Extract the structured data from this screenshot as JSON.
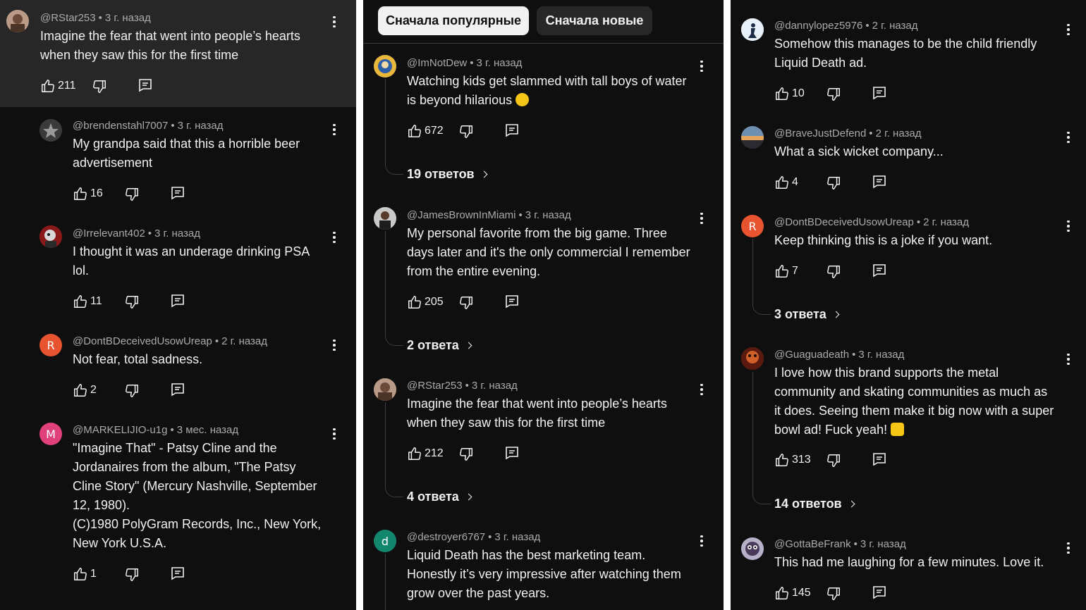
{
  "sort_chips": {
    "popular": "Сначала популярные",
    "new": "Сначала новые"
  },
  "col1": [
    {
      "author": "@RStar253",
      "time": "3 г. назад",
      "text": "Imagine the fear that went into people’s hearts\nwhen they saw this for the first time",
      "likes": "211"
    },
    {
      "author": "@brendenstahl7007",
      "time": "3 г. назад",
      "text": "My grandpa said that this a horrible beer\nadvertisement",
      "likes": "16"
    },
    {
      "author": "@Irrelevant402",
      "time": "3 г. назад",
      "text": "I thought it was an underage drinking PSA\nlol.",
      "likes": "11"
    },
    {
      "author": "@DontBDeceivedUsowUreap",
      "time": "2 г. назад",
      "text": "Not fear, total sadness.",
      "likes": "2",
      "initial": "R"
    },
    {
      "author": "@MARKELIJIO-u1g",
      "time": "3 мес. назад",
      "text": "\"Imagine That\" - Patsy Cline and the\nJordanaires from the album, \"The Patsy\nCline Story\" (Mercury Nashville, September\n12, 1980).\n(C)1980 PolyGram Records, Inc., New York,\nNew York U.S.A.",
      "likes": "1",
      "initial": "M"
    }
  ],
  "col2": [
    {
      "author": "@ImNotDew",
      "time": "3 г. назад",
      "text": "Watching kids get slammed with tall boys of water\nis beyond hilarious",
      "likes": "672",
      "replies": "19 ответов"
    },
    {
      "author": "@JamesBrownInMiami",
      "time": "3 г. назад",
      "text": "My personal favorite from the big game. Three\ndays later and it's the only commercial I remember\nfrom the entire evening.",
      "likes": "205",
      "replies": "2 ответа"
    },
    {
      "author": "@RStar253",
      "time": "3 г. назад",
      "text": "Imagine the fear that went into people’s hearts\nwhen they saw this for the first time",
      "likes": "212",
      "replies": "4 ответа"
    },
    {
      "author": "@destroyer6767",
      "time": "3 г. назад",
      "text": "Liquid Death has the best marketing team.\nHonestly it’s very impressive after watching them\ngrow over the past years.",
      "initial": "d"
    }
  ],
  "col3": [
    {
      "author": "@dannylopez5976",
      "time": "2 г. назад",
      "text": "Somehow this manages to be the child friendly\nLiquid Death ad.",
      "likes": "10"
    },
    {
      "author": "@BraveJustDefend",
      "time": "2 г. назад",
      "text": "What a sick wicket company...",
      "likes": "4"
    },
    {
      "author": "@DontBDeceivedUsowUreap",
      "time": "2 г. назад",
      "text": "Keep thinking this is a joke if you want.",
      "likes": "7",
      "initial": "R",
      "replies": "3 ответа"
    },
    {
      "author": "@Guaguadeath",
      "time": "3 г. назад",
      "text": "I love how this brand supports the metal\ncommunity and skating communities as much as\nit does. Seeing them make it big now with a super\nbowl ad! Fuck yeah!",
      "likes": "313",
      "replies": "14 ответов"
    },
    {
      "author": "@GottaBeFrank",
      "time": "3 г. назад",
      "text": "This had me laughing for a few minutes. Love it.",
      "likes": "145"
    }
  ],
  "colors": {
    "bg": "#0f0f0f",
    "highlight": "#272727",
    "avatar_r": "#e8542f",
    "avatar_m": "#e0417c",
    "avatar_d": "#13876e"
  },
  "icons": [
    "like-icon",
    "dislike-icon",
    "reply-icon",
    "more-icon",
    "chevron-right-icon"
  ]
}
